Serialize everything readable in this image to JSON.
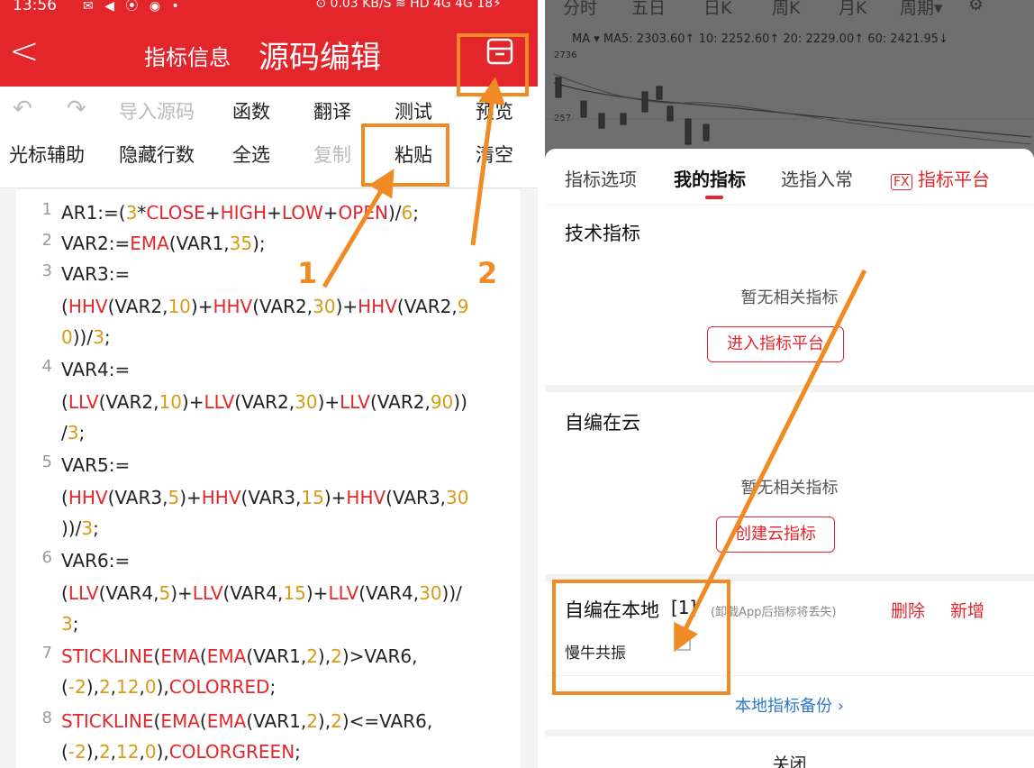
{
  "left": {
    "status": {
      "time": "13:56",
      "icons": "✉ ◀ ⦿ ◉ •",
      "right": "⊙ 0.03 KB/S ≋ HD 4G 4G 18⚡"
    },
    "titlebar": {
      "back": "<",
      "small_title": "指标信息",
      "big_title": "源码编辑",
      "save_icon": "save-icon"
    },
    "toolbar": {
      "undo": "↶",
      "redo": "↷",
      "import": "导入源码",
      "functions": "函数",
      "translate": "翻译",
      "test": "测试",
      "preview": "预览",
      "cursor": "光标辅助",
      "hide_rows": "隐藏行数",
      "select_all": "全选",
      "copy": "复制",
      "paste": "粘贴",
      "clear": "清空"
    },
    "code": [
      {
        "num": "1",
        "text": "AR1:=(3*CLOSE+HIGH+LOW+OPEN)/6;"
      },
      {
        "num": "2",
        "text": "VAR2:=EMA(VAR1,35);"
      },
      {
        "num": "3",
        "text": "VAR3:=(HHV(VAR2,10)+HHV(VAR2,30)+HHV(VAR2,90))/3;"
      },
      {
        "num": "4",
        "text": "VAR4:=(LLV(VAR2,10)+LLV(VAR2,30)+LLV(VAR2,90))/3;"
      },
      {
        "num": "5",
        "text": "VAR5:=(HHV(VAR3,5)+HHV(VAR3,15)+HHV(VAR3,30))/3;"
      },
      {
        "num": "6",
        "text": "VAR6:=(LLV(VAR4,5)+LLV(VAR4,15)+LLV(VAR4,30))/3;"
      },
      {
        "num": "7",
        "text": "STICKLINE(EMA(EMA(VAR1,2),2)>VAR6,(-2),2,12,0),COLORRED;"
      },
      {
        "num": "8",
        "text": "STICKLINE(EMA(EMA(VAR1,2),2)<=VAR6,(-2),2,12,0),COLORGREEN;"
      }
    ]
  },
  "right": {
    "chart_tabs": [
      "分时",
      "五日",
      "日K",
      "周K",
      "月K",
      "周期▾"
    ],
    "ma_line": "MA ▾ MA5: 2303.60↑ 10: 2252.60↑ 20: 2229.00↑ 60: 2421.95↓",
    "axis_top": "2736",
    "axis_mid": "257",
    "sheet_tabs": [
      "指标选项",
      "我的指标",
      "选指入常"
    ],
    "platform": "指标平台",
    "tech_title": "技术指标",
    "tech_empty": "暂无相关指标",
    "tech_button": "进入指标平台",
    "cloud_title": "自编在云",
    "cloud_empty": "暂无相关指标",
    "cloud_button": "创建云指标",
    "local_title": "自编在本地",
    "local_count": "[1]",
    "local_note": "(卸载App后指标将丢失)",
    "delete": "删除",
    "add": "新增",
    "item_name": "慢牛共振",
    "backup": "本地指标备份 ›",
    "close": "关闭"
  },
  "annotations": {
    "one": "1",
    "two": "2"
  },
  "colors": {
    "brand_red": "#e3262b",
    "annotation_orange": "#f08a24",
    "number_gold": "#d99a14",
    "link_blue": "#2d78c8"
  }
}
